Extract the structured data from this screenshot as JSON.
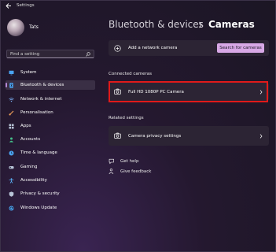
{
  "window": {
    "title": "Settings"
  },
  "user": {
    "name": "Tats"
  },
  "search": {
    "placeholder": "Find a setting"
  },
  "sidebar": {
    "items": [
      {
        "label": "System",
        "icon": "monitor-icon",
        "color": "#4aa3f0",
        "active": false
      },
      {
        "label": "Bluetooth & devices",
        "icon": "bluetooth-icon",
        "color": "#4aa3f0",
        "active": true
      },
      {
        "label": "Network & internet",
        "icon": "wifi-icon",
        "color": "#7fb7ff",
        "active": false
      },
      {
        "label": "Personalisation",
        "icon": "brush-icon",
        "color": "#f4a25c",
        "active": false
      },
      {
        "label": "Apps",
        "icon": "apps-icon",
        "color": "#b7c3d6",
        "active": false
      },
      {
        "label": "Accounts",
        "icon": "person-icon",
        "color": "#44c08a",
        "active": false
      },
      {
        "label": "Time & language",
        "icon": "globe-clock-icon",
        "color": "#4aa3f0",
        "active": false
      },
      {
        "label": "Gaming",
        "icon": "controller-icon",
        "color": "#b7c3d6",
        "active": false
      },
      {
        "label": "Accessibility",
        "icon": "accessibility-icon",
        "color": "#5ab0f5",
        "active": false
      },
      {
        "label": "Privacy & security",
        "icon": "shield-icon",
        "color": "#b7c3d6",
        "active": false
      },
      {
        "label": "Windows Update",
        "icon": "update-icon",
        "color": "#4aa3f0",
        "active": false
      }
    ]
  },
  "breadcrumb": {
    "parent": "Bluetooth & devices",
    "current": "Cameras"
  },
  "add_camera": {
    "label": "Add a network camera",
    "button_label": "Search for cameras"
  },
  "connected": {
    "title": "Connected cameras",
    "cameras": [
      {
        "label": "Full HD 1080P PC Camera"
      }
    ]
  },
  "related": {
    "title": "Related settings",
    "items": [
      {
        "label": "Camera privacy settings"
      }
    ]
  },
  "links": {
    "help": "Get help",
    "feedback": "Give feedback"
  },
  "colors": {
    "accent": "#d8a8e6",
    "highlight_border": "#e01a1a"
  }
}
